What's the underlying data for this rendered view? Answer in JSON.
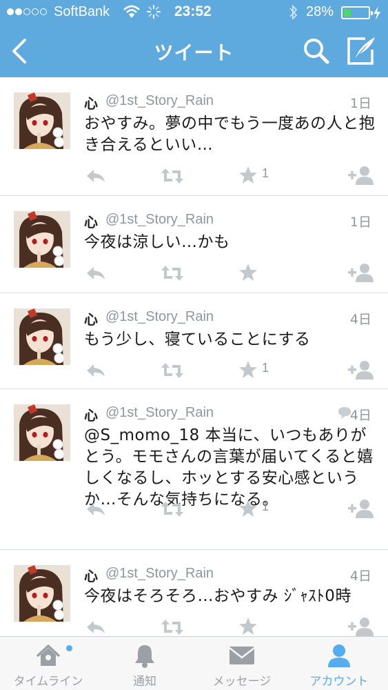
{
  "status_bar": {
    "carrier": "SoftBank",
    "time": "23:52",
    "battery_percent": "28%",
    "battery_level": 0.28
  },
  "nav": {
    "title": "ツイート"
  },
  "tweets": [
    {
      "name": "心",
      "handle": "@1st_Story_Rain",
      "time": "1日",
      "text": "おやすみ。夢の中でもう一度あの人と抱き合えるといい…",
      "favorites": "1"
    },
    {
      "name": "心",
      "handle": "@1st_Story_Rain",
      "time": "1日",
      "text": "今夜は涼しい…かも",
      "favorites": ""
    },
    {
      "name": "心",
      "handle": "@1st_Story_Rain",
      "time": "4日",
      "text": "もう少し、寝ていることにする",
      "favorites": "1"
    },
    {
      "name": "心",
      "handle": "@1st_Story_Rain",
      "time": "4日",
      "text": "@S_momo_18 本当に、いつもありがとう。モモさんの言葉が届いてくると嬉しくなるし、ホッとする安心感というか…そんな気持ちになる。",
      "favorites": "1"
    },
    {
      "name": "心",
      "handle": "@1st_Story_Rain",
      "time": "4日",
      "text": "今夜はそろそろ…おやすみ ｼﾞｬｽﾄ0時",
      "favorites": ""
    }
  ],
  "tabbar": {
    "items": [
      {
        "label": "タイムライン",
        "icon": "home-icon"
      },
      {
        "label": "通知",
        "icon": "bell-icon"
      },
      {
        "label": "メッセージ",
        "icon": "envelope-icon"
      },
      {
        "label": "アカウント",
        "icon": "person-icon"
      }
    ],
    "active": "アカウント"
  },
  "colors": {
    "nav_bg": "#5ea9dd",
    "accent": "#55acee",
    "muted": "#8e969e",
    "action_gray": "#c3c8cd"
  }
}
